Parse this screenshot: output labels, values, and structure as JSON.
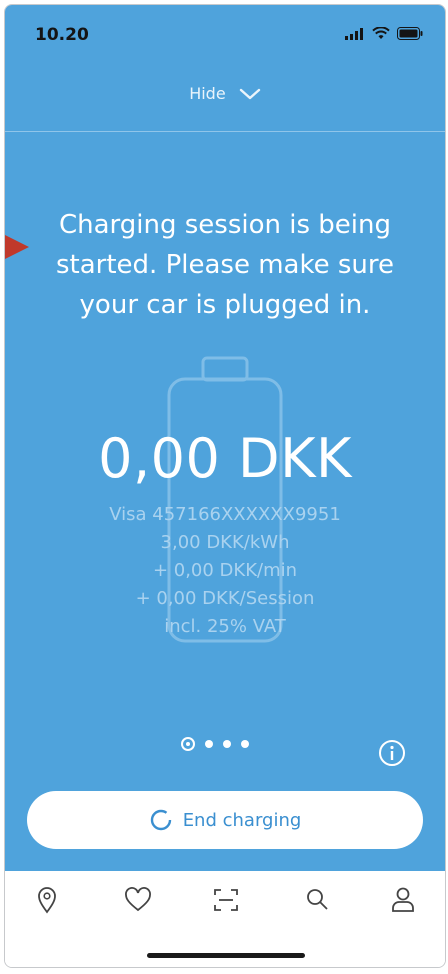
{
  "status_bar": {
    "time": "10.20"
  },
  "header": {
    "hide_label": "Hide"
  },
  "message": "Charging session is being started. Please make sure your car is plugged in.",
  "amount": "0,00 DKK",
  "details": [
    "Visa 457166XXXXXX9951",
    "3,00 DKK/kWh",
    "+ 0,00 DKK/min",
    "+ 0,00 DKK/Session",
    "incl. 25% VAT"
  ],
  "pagination": {
    "pages": 4,
    "current": 1
  },
  "end_button": {
    "label": "End charging"
  },
  "tabbar": [
    "location-pin-icon",
    "heart-icon",
    "scan-icon",
    "search-icon",
    "profile-icon"
  ],
  "colors": {
    "background": "#4fa3dc",
    "accent": "#3a8fd0",
    "arrow": "#c0392b"
  }
}
